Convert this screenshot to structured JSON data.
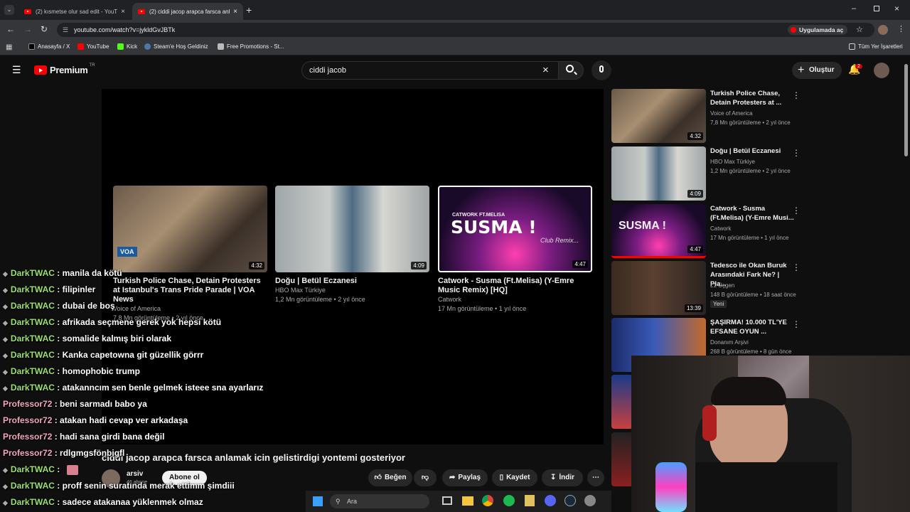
{
  "browser": {
    "tabs": [
      {
        "title": "(2) kısmetse olur sad edit - YouT",
        "active": false
      },
      {
        "title": "(2) ciddi jacop arapca farsca anl",
        "active": true
      }
    ],
    "url": "youtube.com/watch?v=jykldGvJBTk",
    "open_in_app": "Uygulamada aç",
    "bookmarks": [
      "Anasayfa / X",
      "YouTube",
      "Kick",
      "Steam'e Hoş Geldiniz",
      "Free Promotions - St...",
      "Tüm Yer İşaretleri"
    ]
  },
  "youtube": {
    "logo": "Premium",
    "logo_region": "TR",
    "search_value": "ciddi jacob",
    "create_label": "Oluştur",
    "notif_count": "2"
  },
  "end_cards": [
    {
      "title": "Turkish Police Chase, Detain Protesters at Istanbul's Trans Pride Parade | VOA News",
      "channel": "Voice of America",
      "meta": "7,8 Mn görüntüleme • 2 yıl önce",
      "duration": "4:32"
    },
    {
      "title": "Doğu | Betül Eczanesi",
      "channel": "HBO Max Türkiye",
      "meta": "1,2 Mn görüntüleme • 2 yıl önce",
      "duration": "4:09"
    },
    {
      "title": "Catwork - Susma (Ft.Melisa) (Y-Emre Music Remix) [HQ]",
      "channel": "Catwork",
      "meta": "17 Mn görüntüleme • 1 yıl önce",
      "duration": "4:47"
    }
  ],
  "susma_text": "SUSMA !",
  "susma_sub": "CATWORK FT.MELISA",
  "susma_remix": "Club Remix...",
  "voa_badge": "VOA",
  "sidebar": [
    {
      "title": "Turkish Police Chase, Detain Protesters at ...",
      "channel": "Voice of America",
      "meta": "7,8 Mn görüntüleme • 2 yıl önce",
      "duration": "4:32",
      "badge": ""
    },
    {
      "title": "Doğu | Betül Eczanesi",
      "channel": "HBO Max Türkiye",
      "meta": "1,2 Mn görüntüleme • 2 yıl önce",
      "duration": "4:09",
      "badge": ""
    },
    {
      "title": "Catwork - Susma (Ft.Melisa) (Y-Emre Musi...",
      "channel": "Catwork",
      "meta": "17 Mn görüntüleme • 1 yıl önce",
      "duration": "4:47",
      "badge": ""
    },
    {
      "title": "Tedesco ile Okan Buruk Arasındaki Fark Ne? | Pla...",
      "channel": "L1 Üçgen",
      "meta": "148 B görüntüleme • 18 saat önce",
      "duration": "13:39",
      "badge": "Yeni"
    },
    {
      "title": "ŞAŞIRMA! 10.000 TL'YE EFSANE OYUN ...",
      "channel": "Donanım Arşivi",
      "meta": "268 B görüntüleme • 8 gün önce",
      "duration": "",
      "badge": ""
    }
  ],
  "video_title": "ciddi jacop arapca farsca anlamak icin gelistirdigi yontemi gosteriyor",
  "channel": {
    "name": "arsiv",
    "subs": "46 abone",
    "subscribe": "Abone ol"
  },
  "actions": {
    "like": "Beğen",
    "share": "Paylaş",
    "save": "Kaydet",
    "download": "İndir"
  },
  "chat": [
    {
      "user": "DarkTWAC",
      "msg": ": manila da kötü",
      "pro": false
    },
    {
      "user": "DarkTWAC",
      "msg": ": filipinler",
      "pro": false
    },
    {
      "user": "DarkTWAC",
      "msg": ": dubai de boş",
      "pro": false
    },
    {
      "user": "DarkTWAC",
      "msg": ": afrikada seçmene gerek yok hepsi kötü",
      "pro": false
    },
    {
      "user": "DarkTWAC",
      "msg": ": somalide kalmış biri olarak",
      "pro": false
    },
    {
      "user": "DarkTWAC",
      "msg": ": Kanka capetowna git güzellik görrr",
      "pro": false
    },
    {
      "user": "DarkTWAC",
      "msg": ": homophobic trump",
      "pro": false
    },
    {
      "user": "DarkTWAC",
      "msg": ": atakanncım sen benle gelmek isteee sna ayarlarız",
      "pro": false
    },
    {
      "user": "Professor72",
      "msg": ": beni sarmadı babo ya",
      "pro": true
    },
    {
      "user": "Professor72",
      "msg": ": atakan hadi cevap ver arkadaşa",
      "pro": true
    },
    {
      "user": "Professor72",
      "msg": ": hadi sana girdi bana değil",
      "pro": true
    },
    {
      "user": "Professor72",
      "msg": ": rdlgmgsfönbigfl",
      "pro": true
    },
    {
      "user": "DarkTWAC",
      "msg": ":",
      "pro": false
    },
    {
      "user": "DarkTWAC",
      "msg": ": proff senin suratında merak ettimm şimdiii",
      "pro": false
    },
    {
      "user": "DarkTWAC",
      "msg": ": sadece atakanaa yüklenmek olmaz",
      "pro": false
    }
  ],
  "taskbar": {
    "search": "Ara"
  },
  "colors": {
    "yt_red": "#ff0000",
    "chat_dark": "#9ae16a",
    "chat_prof": "#f5a5c0"
  }
}
